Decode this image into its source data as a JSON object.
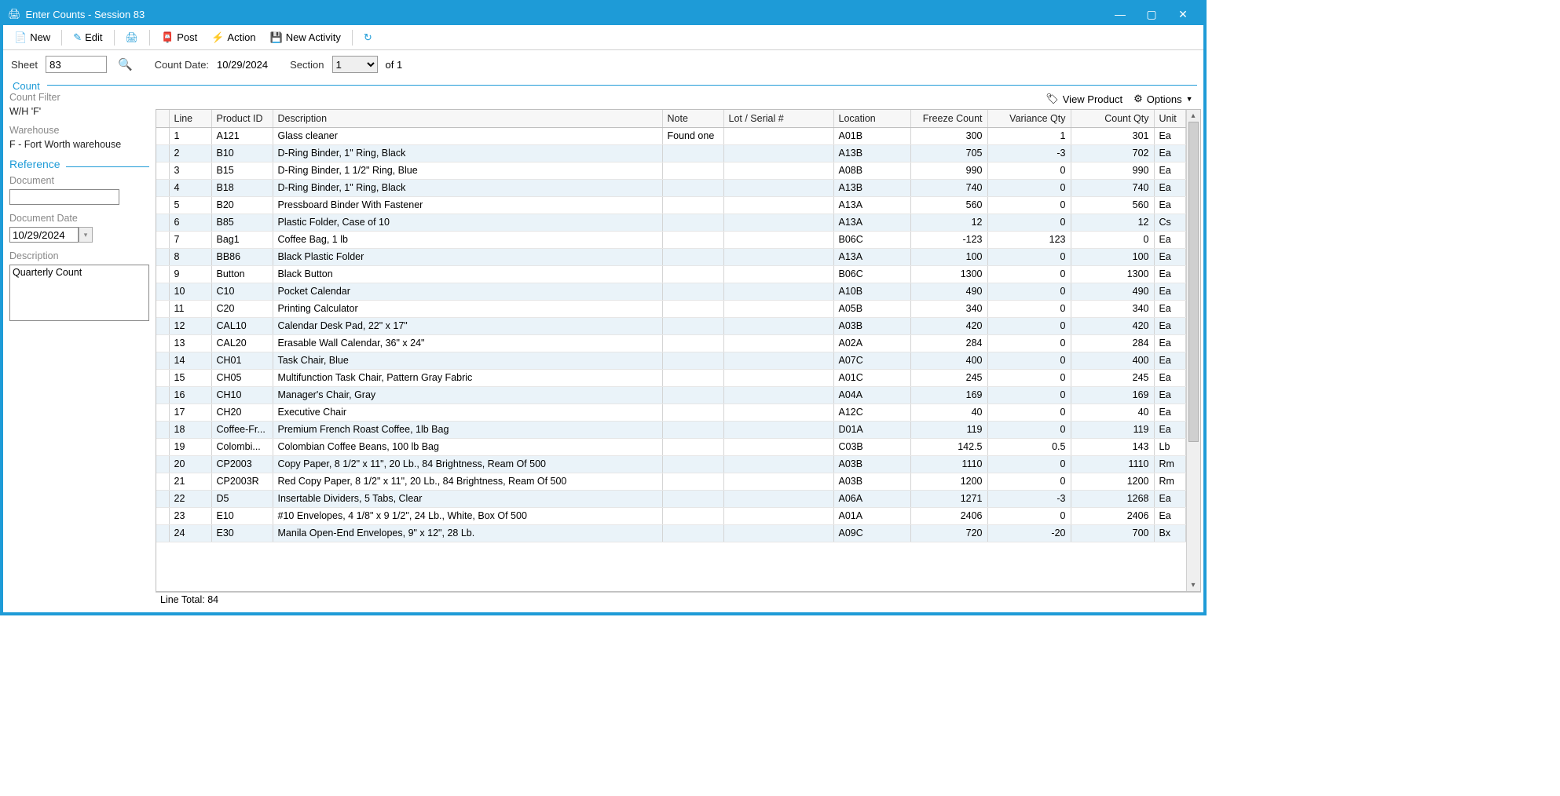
{
  "window": {
    "title": "Enter Counts - Session 83"
  },
  "toolbar": {
    "new": "New",
    "edit": "Edit",
    "post": "Post",
    "action": "Action",
    "newActivity": "New Activity"
  },
  "params": {
    "sheetLabel": "Sheet",
    "sheetValue": "83",
    "countDateLabel": "Count Date:",
    "countDateValue": "10/29/2024",
    "sectionLabel": "Section",
    "sectionValue": "1",
    "sectionOf": "of 1"
  },
  "group": {
    "title": "Count",
    "filterLabel": "Count Filter",
    "filterValue": "W/H 'F'",
    "warehouseLabel": "Warehouse",
    "warehouseValue": "F - Fort Worth warehouse"
  },
  "reference": {
    "title": "Reference",
    "documentLabel": "Document",
    "documentValue": "",
    "docDateLabel": "Document Date",
    "docDateValue": "10/29/2024",
    "descLabel": "Description",
    "descValue": "Quarterly Count"
  },
  "actions": {
    "viewProduct": "View Product",
    "options": "Options"
  },
  "columns": {
    "line": "Line",
    "productId": "Product ID",
    "description": "Description",
    "note": "Note",
    "lot": "Lot / Serial #",
    "location": "Location",
    "freeze": "Freeze Count",
    "variance": "Variance Qty",
    "count": "Count Qty",
    "unit": "Unit"
  },
  "rows": [
    {
      "line": "1",
      "pid": "A121",
      "desc": "Glass cleaner",
      "note": "Found one",
      "lot": "",
      "loc": "A01B",
      "fc": "300",
      "vq": "1",
      "cq": "301",
      "unit": "Ea"
    },
    {
      "line": "2",
      "pid": "B10",
      "desc": "D-Ring Binder, 1\" Ring, Black",
      "note": "",
      "lot": "",
      "loc": "A13B",
      "fc": "705",
      "vq": "-3",
      "cq": "702",
      "unit": "Ea"
    },
    {
      "line": "3",
      "pid": "B15",
      "desc": "D-Ring Binder, 1 1/2\" Ring, Blue",
      "note": "",
      "lot": "",
      "loc": "A08B",
      "fc": "990",
      "vq": "0",
      "cq": "990",
      "unit": "Ea"
    },
    {
      "line": "4",
      "pid": "B18",
      "desc": "D-Ring Binder, 1\" Ring, Black",
      "note": "",
      "lot": "",
      "loc": "A13B",
      "fc": "740",
      "vq": "0",
      "cq": "740",
      "unit": "Ea"
    },
    {
      "line": "5",
      "pid": "B20",
      "desc": "Pressboard Binder With Fastener",
      "note": "",
      "lot": "",
      "loc": "A13A",
      "fc": "560",
      "vq": "0",
      "cq": "560",
      "unit": "Ea"
    },
    {
      "line": "6",
      "pid": "B85",
      "desc": "Plastic Folder, Case of 10",
      "note": "",
      "lot": "",
      "loc": "A13A",
      "fc": "12",
      "vq": "0",
      "cq": "12",
      "unit": "Cs"
    },
    {
      "line": "7",
      "pid": "Bag1",
      "desc": "Coffee Bag, 1 lb",
      "note": "",
      "lot": "",
      "loc": "B06C",
      "fc": "-123",
      "vq": "123",
      "cq": "0",
      "unit": "Ea"
    },
    {
      "line": "8",
      "pid": "BB86",
      "desc": "Black Plastic Folder",
      "note": "",
      "lot": "",
      "loc": "A13A",
      "fc": "100",
      "vq": "0",
      "cq": "100",
      "unit": "Ea"
    },
    {
      "line": "9",
      "pid": "Button",
      "desc": "Black Button",
      "note": "",
      "lot": "",
      "loc": "B06C",
      "fc": "1300",
      "vq": "0",
      "cq": "1300",
      "unit": "Ea"
    },
    {
      "line": "10",
      "pid": "C10",
      "desc": "Pocket Calendar",
      "note": "",
      "lot": "",
      "loc": "A10B",
      "fc": "490",
      "vq": "0",
      "cq": "490",
      "unit": "Ea"
    },
    {
      "line": "11",
      "pid": "C20",
      "desc": "Printing Calculator",
      "note": "",
      "lot": "",
      "loc": "A05B",
      "fc": "340",
      "vq": "0",
      "cq": "340",
      "unit": "Ea"
    },
    {
      "line": "12",
      "pid": "CAL10",
      "desc": "Calendar Desk Pad, 22\" x 17\"",
      "note": "",
      "lot": "",
      "loc": "A03B",
      "fc": "420",
      "vq": "0",
      "cq": "420",
      "unit": "Ea"
    },
    {
      "line": "13",
      "pid": "CAL20",
      "desc": "Erasable Wall Calendar, 36\" x 24\"",
      "note": "",
      "lot": "",
      "loc": "A02A",
      "fc": "284",
      "vq": "0",
      "cq": "284",
      "unit": "Ea"
    },
    {
      "line": "14",
      "pid": "CH01",
      "desc": "Task Chair, Blue",
      "note": "",
      "lot": "",
      "loc": "A07C",
      "fc": "400",
      "vq": "0",
      "cq": "400",
      "unit": "Ea"
    },
    {
      "line": "15",
      "pid": "CH05",
      "desc": "Multifunction Task Chair, Pattern Gray Fabric",
      "note": "",
      "lot": "",
      "loc": "A01C",
      "fc": "245",
      "vq": "0",
      "cq": "245",
      "unit": "Ea"
    },
    {
      "line": "16",
      "pid": "CH10",
      "desc": "Manager's Chair, Gray",
      "note": "",
      "lot": "",
      "loc": "A04A",
      "fc": "169",
      "vq": "0",
      "cq": "169",
      "unit": "Ea"
    },
    {
      "line": "17",
      "pid": "CH20",
      "desc": "Executive Chair",
      "note": "",
      "lot": "",
      "loc": "A12C",
      "fc": "40",
      "vq": "0",
      "cq": "40",
      "unit": "Ea"
    },
    {
      "line": "18",
      "pid": "Coffee-Fr...",
      "desc": "Premium French Roast Coffee, 1lb Bag",
      "note": "",
      "lot": "",
      "loc": "D01A",
      "fc": "119",
      "vq": "0",
      "cq": "119",
      "unit": "Ea"
    },
    {
      "line": "19",
      "pid": "Colombi...",
      "desc": "Colombian Coffee Beans, 100 lb Bag",
      "note": "",
      "lot": "",
      "loc": "C03B",
      "fc": "142.5",
      "vq": "0.5",
      "cq": "143",
      "unit": "Lb"
    },
    {
      "line": "20",
      "pid": "CP2003",
      "desc": "Copy Paper, 8 1/2\" x 11\", 20 Lb., 84 Brightness, Ream Of 500",
      "note": "",
      "lot": "",
      "loc": "A03B",
      "fc": "1110",
      "vq": "0",
      "cq": "1110",
      "unit": "Rm"
    },
    {
      "line": "21",
      "pid": "CP2003R",
      "desc": "Red Copy Paper, 8 1/2\" x 11\", 20 Lb., 84 Brightness, Ream Of 500",
      "note": "",
      "lot": "",
      "loc": "A03B",
      "fc": "1200",
      "vq": "0",
      "cq": "1200",
      "unit": "Rm"
    },
    {
      "line": "22",
      "pid": "D5",
      "desc": "Insertable Dividers, 5 Tabs, Clear",
      "note": "",
      "lot": "",
      "loc": "A06A",
      "fc": "1271",
      "vq": "-3",
      "cq": "1268",
      "unit": "Ea"
    },
    {
      "line": "23",
      "pid": "E10",
      "desc": "#10 Envelopes, 4 1/8\" x 9 1/2\", 24 Lb., White, Box Of 500",
      "note": "",
      "lot": "",
      "loc": "A01A",
      "fc": "2406",
      "vq": "0",
      "cq": "2406",
      "unit": "Ea"
    },
    {
      "line": "24",
      "pid": "E30",
      "desc": "Manila Open-End Envelopes, 9\" x 12\", 28 Lb.",
      "note": "",
      "lot": "",
      "loc": "A09C",
      "fc": "720",
      "vq": "-20",
      "cq": "700",
      "unit": "Bx"
    }
  ],
  "footer": {
    "lineTotal": "Line Total: 84"
  }
}
